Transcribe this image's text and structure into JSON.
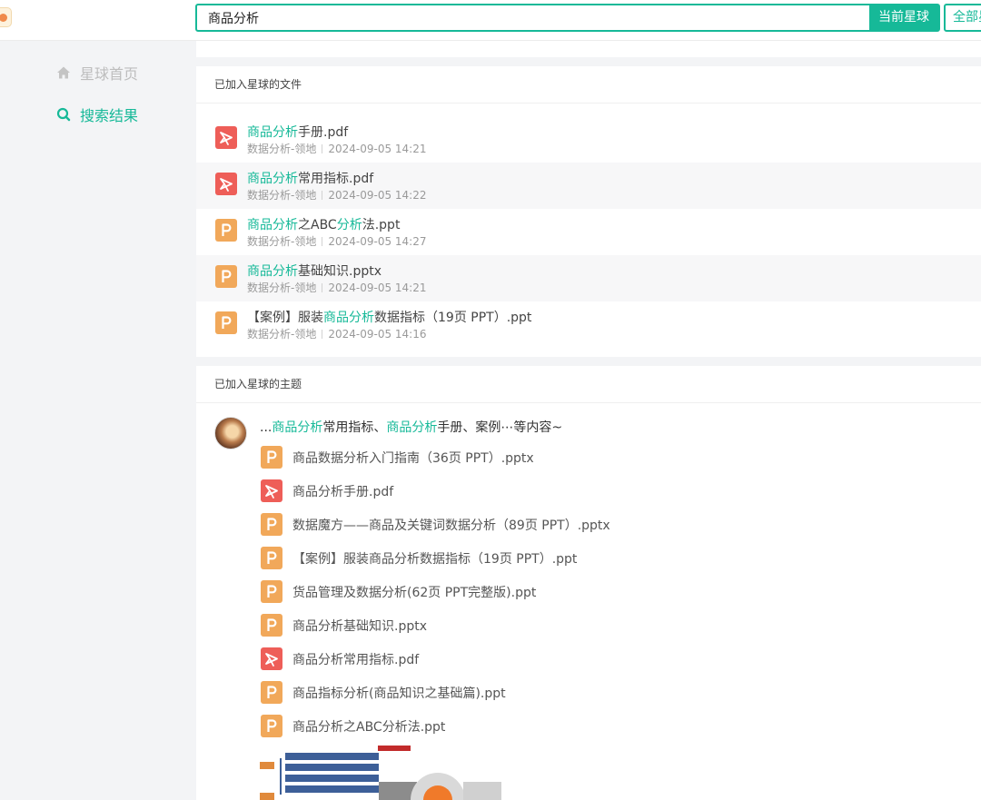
{
  "search": {
    "query": "商品分析",
    "current_button": "当前星球",
    "all_button": "全部星球"
  },
  "sidebar": {
    "items": [
      {
        "label": "星球首页",
        "icon": "home-icon",
        "active": false
      },
      {
        "label": "搜索结果",
        "icon": "search-icon",
        "active": true
      }
    ]
  },
  "files_section": {
    "title": "已加入星球的文件",
    "items": [
      {
        "type": "pdf",
        "name_parts": [
          {
            "t": "商品分析",
            "hl": true
          },
          {
            "t": "手册.pdf",
            "hl": false
          }
        ],
        "source": "数据分析-领地",
        "date": "2024-09-05 14:21"
      },
      {
        "type": "pdf",
        "name_parts": [
          {
            "t": "商品分析",
            "hl": true
          },
          {
            "t": "常用指标.pdf",
            "hl": false
          }
        ],
        "source": "数据分析-领地",
        "date": "2024-09-05 14:22"
      },
      {
        "type": "ppt",
        "name_parts": [
          {
            "t": "商品分析",
            "hl": true
          },
          {
            "t": "之ABC",
            "hl": false
          },
          {
            "t": "分析",
            "hl": true
          },
          {
            "t": "法.ppt",
            "hl": false
          }
        ],
        "source": "数据分析-领地",
        "date": "2024-09-05 14:27"
      },
      {
        "type": "ppt",
        "name_parts": [
          {
            "t": "商品分析",
            "hl": true
          },
          {
            "t": "基础知识.pptx",
            "hl": false
          }
        ],
        "source": "数据分析-领地",
        "date": "2024-09-05 14:21"
      },
      {
        "type": "ppt",
        "name_parts": [
          {
            "t": "【案例】服装",
            "hl": false
          },
          {
            "t": "商品分析",
            "hl": true
          },
          {
            "t": "数据指标（19页 PPT）.ppt",
            "hl": false
          }
        ],
        "source": "数据分析-领地",
        "date": "2024-09-05 14:16"
      }
    ]
  },
  "topics_section": {
    "title": "已加入星球的主题",
    "excerpt_parts": [
      {
        "t": "...",
        "hl": false
      },
      {
        "t": "商品分析",
        "hl": true
      },
      {
        "t": "常用指标、",
        "hl": false
      },
      {
        "t": "商品分析",
        "hl": true
      },
      {
        "t": "手册、案例⋯等内容~",
        "hl": false
      }
    ],
    "attachments": [
      {
        "type": "ppt",
        "name": "商品数据分析入门指南（36页 PPT）.pptx"
      },
      {
        "type": "pdf",
        "name": "商品分析手册.pdf"
      },
      {
        "type": "ppt",
        "name": "数据魔方——商品及关键词数据分析（89页 PPT）.pptx"
      },
      {
        "type": "ppt",
        "name": "【案例】服装商品分析数据指标（19页 PPT）.ppt"
      },
      {
        "type": "ppt",
        "name": "货品管理及数据分析(62页 PPT完整版).ppt"
      },
      {
        "type": "ppt",
        "name": "商品分析基础知识.pptx"
      },
      {
        "type": "pdf",
        "name": "商品分析常用指标.pdf"
      },
      {
        "type": "ppt",
        "name": "商品指标分析(商品知识之基础篇).ppt"
      },
      {
        "type": "ppt",
        "name": "商品分析之ABC分析法.ppt"
      }
    ]
  },
  "colors": {
    "accent": "#16b998",
    "pdf": "#ee5e58",
    "ppt": "#f1a85a"
  }
}
